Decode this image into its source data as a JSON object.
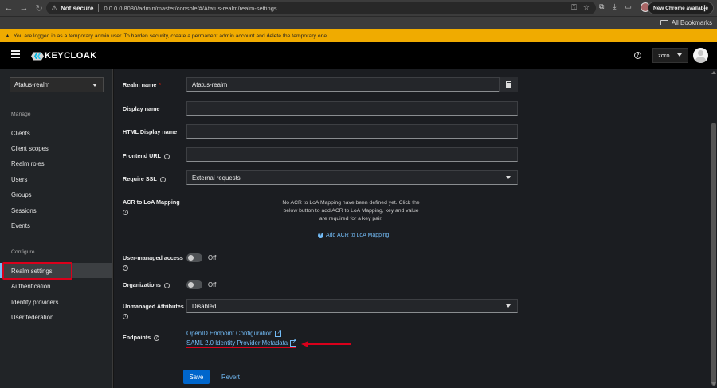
{
  "browser": {
    "security_label": "Not secure",
    "url": "0.0.0.0:8080/admin/master/console/#/Atatus-realm/realm-settings",
    "new_chrome_label": "New Chrome available",
    "bookmarks_label": "All Bookmarks"
  },
  "banner": {
    "text": "You are logged in as a temporary admin user. To harden security, create a permanent admin account and delete the temporary one."
  },
  "header": {
    "logo_text": "KEYCLOAK",
    "user_name": "zoro"
  },
  "sidebar": {
    "realm": "Atatus-realm",
    "manage_title": "Manage",
    "manage_items": [
      "Clients",
      "Client scopes",
      "Realm roles",
      "Users",
      "Groups",
      "Sessions",
      "Events"
    ],
    "configure_title": "Configure",
    "configure_items": [
      "Realm settings",
      "Authentication",
      "Identity providers",
      "User federation"
    ],
    "active_item": "Realm settings"
  },
  "form": {
    "realm_name_label": "Realm name",
    "realm_name_value": "Atatus-realm",
    "display_name_label": "Display name",
    "display_name_value": "",
    "html_display_name_label": "HTML Display name",
    "html_display_name_value": "",
    "frontend_url_label": "Frontend URL",
    "frontend_url_value": "",
    "require_ssl_label": "Require SSL",
    "require_ssl_value": "External requests",
    "acr_label": "ACR to LoA Mapping",
    "acr_empty_text": "No ACR to LoA Mapping have been defined yet. Click the below button to add ACR to LoA Mapping, key and value are required for a key pair.",
    "acr_add_link": "Add ACR to LoA Mapping",
    "user_managed_access_label": "User-managed access",
    "user_managed_access_state": "Off",
    "organizations_label": "Organizations",
    "organizations_state": "Off",
    "unmanaged_attributes_label": "Unmanaged Attributes",
    "unmanaged_attributes_value": "Disabled",
    "endpoints_label": "Endpoints",
    "endpoint_links": [
      "OpenID Endpoint Configuration",
      "SAML 2.0 Identity Provider Metadata"
    ],
    "save_label": "Save",
    "revert_label": "Revert"
  },
  "colors": {
    "banner": "#f0ab00",
    "link": "#73bcf7",
    "primary_button": "#0066cc",
    "annotation_red": "#d9001b"
  }
}
